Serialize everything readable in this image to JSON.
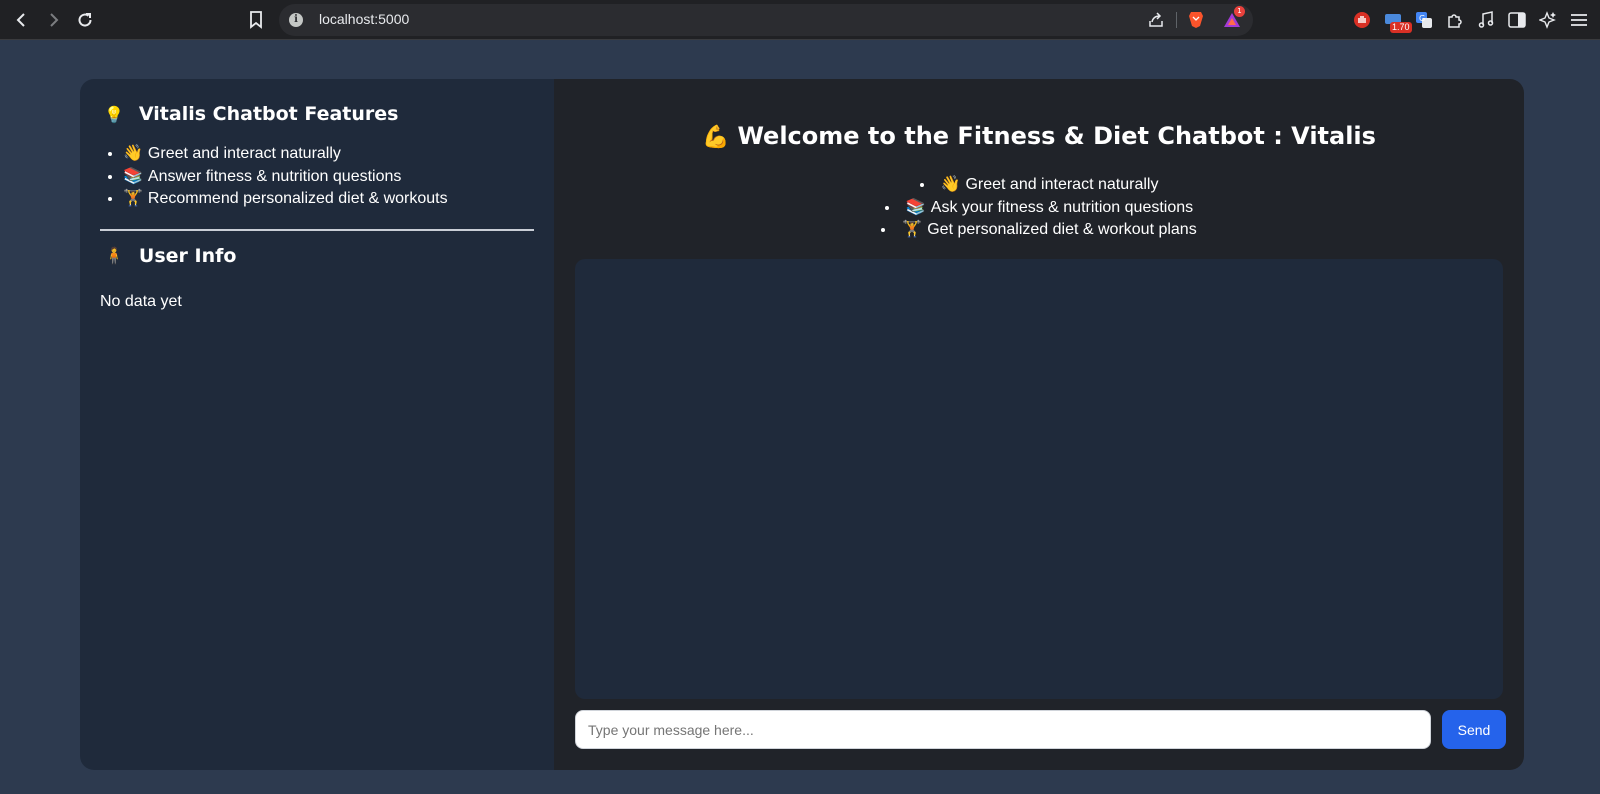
{
  "browser": {
    "url": "localhost:5000",
    "ext_badge": "1.70",
    "icons": [
      "back-icon",
      "forward-icon",
      "reload-icon",
      "bookmark-icon",
      "site-info-icon",
      "share-icon",
      "brave-shield-icon",
      "brave-rewards-icon",
      "extension-hand-icon",
      "extension-speed-icon",
      "translate-icon",
      "puzzle-icon",
      "media-icon",
      "sidebar-icon",
      "leo-icon",
      "menu-icon"
    ]
  },
  "sidebar": {
    "features_title": "Vitalis Chatbot Features",
    "features_emoji": "💡",
    "features": [
      {
        "emoji": "👋",
        "text": "Greet and interact naturally"
      },
      {
        "emoji": "📚",
        "text": "Answer fitness & nutrition questions"
      },
      {
        "emoji": "🏋",
        "text": "Recommend personalized diet & workouts"
      }
    ],
    "userinfo_title": "User Info",
    "userinfo_emoji": "🧍",
    "no_data": "No data yet"
  },
  "main": {
    "title_emoji": "💪",
    "title": "Welcome to the Fitness & Diet Chatbot : Vitalis",
    "bullets": [
      {
        "emoji": "👋",
        "text": "Greet and interact naturally"
      },
      {
        "emoji": "📚",
        "text": "Ask your fitness & nutrition questions"
      },
      {
        "emoji": "🏋",
        "text": "Get personalized diet & workout plans"
      }
    ],
    "input_placeholder": "Type your message here...",
    "send_label": "Send"
  },
  "colors": {
    "page_bg": "#2d3a4f",
    "sidebar_bg": "#1f2a3b",
    "main_bg": "#202329",
    "send_button": "#2563eb"
  }
}
